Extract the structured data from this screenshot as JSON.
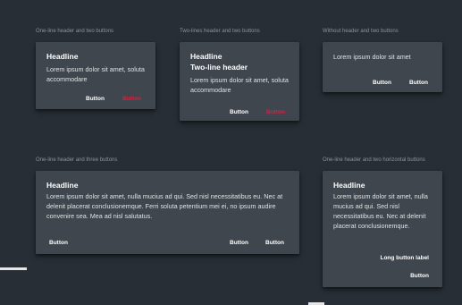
{
  "section_labels": {
    "one_line_two": "One-line header and two buttons",
    "two_lines_two": "Two-lines header and two buttons",
    "without_header": "Without header and two buttons",
    "one_line_three": "One-line header and three buttons",
    "one_line_two_horizontal": "One-line header and two horizontal buttons"
  },
  "card1": {
    "headline": "Headline",
    "body": "Lorem ipsum dolor sit amet, soluta accommodare",
    "buttons": [
      "Button",
      "Button"
    ]
  },
  "card2": {
    "headline_line1": "Headline",
    "headline_line2": "Two-line header",
    "body": "Lorem ipsum dolor sit amet, soluta accommodare",
    "buttons": [
      "Button",
      "Button"
    ]
  },
  "card3": {
    "body": "Lorem ipsum dolor sit amet",
    "buttons": [
      "Button",
      "Button"
    ]
  },
  "card4": {
    "headline": "Headline",
    "body": "Lorem ipsum dolor sit amet, nulla mucius ad qui. Sed nisl necessitatibus eu. Nec at delenit placerat conclusionemque. Ferri soluta petentium mei ei, no ipsum audire convenire sea. Mea ad nisl salutatus.",
    "buttons": [
      "Button",
      "Button",
      "Button"
    ]
  },
  "card5": {
    "headline": "Headline",
    "body": "Lorem ipsum dolor sit amet, nulla mucius ad qui. Sed nisl necessitatibus eu. Nec at delenit placerat conclusionemque.",
    "buttons": [
      "Long button label",
      "Button"
    ]
  },
  "colors": {
    "background": "#272e35",
    "card": "#3f464d",
    "accent": "#d8213c"
  }
}
